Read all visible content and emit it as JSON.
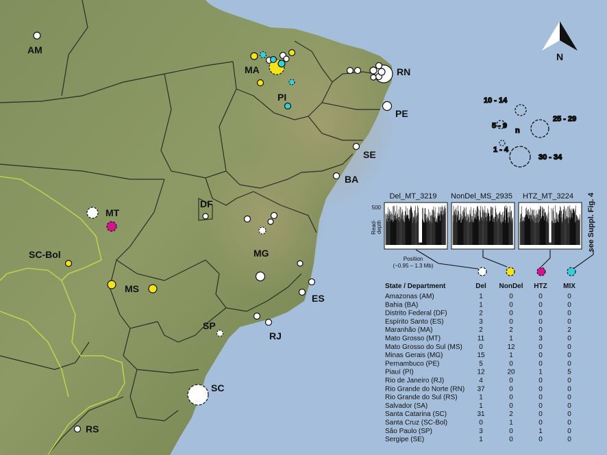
{
  "colors": {
    "ocean": "#a5bedb",
    "land": "#8a9767",
    "del": "#ffffff",
    "nondel": "#f4e417",
    "htz": "#d4148c",
    "mix": "#35d0de"
  },
  "compass": {
    "label": "N",
    "icon": "north-arrow-icon"
  },
  "state_labels": [
    "AM",
    "MA",
    "RN",
    "PI",
    "PE",
    "SE",
    "BA",
    "MT",
    "DF",
    "SC-Bol",
    "MG",
    "MS",
    "ES",
    "SP",
    "RJ",
    "SC",
    "RS"
  ],
  "legend": {
    "n_label": "n",
    "sizes": [
      {
        "label": "10 - 14",
        "n": 12
      },
      {
        "label": "5 - 9",
        "n": 7
      },
      {
        "label": "1 - 4",
        "n": 2
      },
      {
        "label": "25 - 29",
        "n": 27
      },
      {
        "label": "30 - 34",
        "n": 32
      }
    ]
  },
  "inset": {
    "panels": [
      {
        "title": "Del_MT_3219",
        "type": "del"
      },
      {
        "title": "NonDel_MS_2935",
        "type": "nondel"
      },
      {
        "title": "HTZ_MT_3224",
        "type": "htz"
      }
    ],
    "y_tick": "500",
    "y_label_1": "Read-",
    "y_label_2": "depth",
    "x_label": "Position",
    "x_range": "(~0.95 – 1.3 Mb)",
    "side_note": "see Suppl. Fig. 4"
  },
  "table": {
    "headers": [
      "State / Department",
      "Del",
      "NonDel",
      "HTZ",
      "MIX"
    ],
    "rows": [
      [
        "Amazonas (AM)",
        "1",
        "0",
        "0",
        "0"
      ],
      [
        "Bahia (BA)",
        "1",
        "0",
        "0",
        "0"
      ],
      [
        "Distrito Federal (DF)",
        "2",
        "0",
        "0",
        "0"
      ],
      [
        "Espírito Santo (ES)",
        "3",
        "0",
        "0",
        "0"
      ],
      [
        "Maranhão (MA)",
        "2",
        "2",
        "0",
        "2"
      ],
      [
        "Mato Grosso (MT)",
        "11",
        "1",
        "3",
        "0"
      ],
      [
        "Mato Grosso do Sul (MS)",
        "0",
        "12",
        "0",
        "0"
      ],
      [
        "Minas Gerais (MG)",
        "15",
        "1",
        "0",
        "0"
      ],
      [
        "Pernambuco (PE)",
        "5",
        "0",
        "0",
        "0"
      ],
      [
        "Piauí (PI)",
        "12",
        "20",
        "1",
        "5"
      ],
      [
        "Rio de Janeiro (RJ)",
        "4",
        "0",
        "0",
        "0"
      ],
      [
        "Rio Grande do Norte (RN)",
        "37",
        "0",
        "0",
        "0"
      ],
      [
        "Rio Grande do Sul (RS)",
        "1",
        "0",
        "0",
        "0"
      ],
      [
        "Salvador (SA)",
        "1",
        "0",
        "0",
        "0"
      ],
      [
        "Santa Catarina (SC)",
        "31",
        "2",
        "0",
        "0"
      ],
      [
        "Santa Cruz (SC-Bol)",
        "0",
        "1",
        "0",
        "0"
      ],
      [
        "São Paulo (SP)",
        "3",
        "0",
        "1",
        "0"
      ],
      [
        "Sergipe (SE)",
        "1",
        "0",
        "0",
        "0"
      ]
    ]
  }
}
